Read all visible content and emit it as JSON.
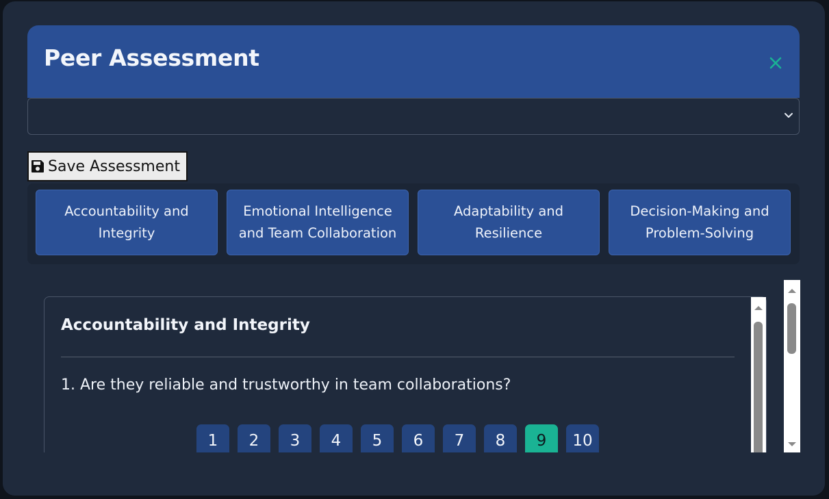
{
  "modal": {
    "title": "Peer Assessment",
    "close_icon": "close-icon",
    "select_value": "",
    "save_label": "Save Assessment",
    "save_icon": "floppy-disk-icon"
  },
  "tabs": [
    {
      "label": "Accountability and Integrity"
    },
    {
      "label": "Emotional Intelligence and Team Collaboration"
    },
    {
      "label": "Adaptability and Resilience"
    },
    {
      "label": "Decision-Making and Problem-Solving"
    }
  ],
  "section": {
    "title": "Accountability and Integrity",
    "question": "1. Are they reliable and trustworthy in team collaborations?",
    "ratings": [
      "1",
      "2",
      "3",
      "4",
      "5",
      "6",
      "7",
      "8",
      "9",
      "10"
    ],
    "selected": "9"
  },
  "colors": {
    "accent": "#1ab394",
    "header": "#2a4f95",
    "background": "#1f2a3c"
  }
}
